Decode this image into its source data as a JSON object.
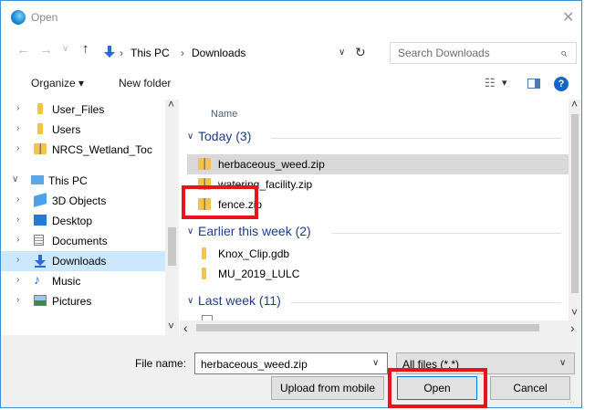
{
  "window": {
    "title": "Open",
    "close_glyph": "✕",
    "icon": "edge-browser-icon"
  },
  "nav": {
    "back_glyph": "←",
    "forward_glyph": "→",
    "recent_glyph": "∨",
    "up_glyph": "↑",
    "breadcrumb": [
      "This PC",
      "Downloads"
    ],
    "separator": "›",
    "dropdown_glyph": "∨",
    "refresh_glyph": "↻",
    "search_placeholder": "Search Downloads",
    "search_glyph": "⌕"
  },
  "toolbar": {
    "organize_label": "Organize",
    "organize_caret": "▾",
    "new_folder_label": "New folder",
    "view_glyph": "☷",
    "view_caret": "▾",
    "help_glyph": "?"
  },
  "tree": [
    {
      "label": "User_Files",
      "icon": "folder-icon",
      "chevron": "›"
    },
    {
      "label": "Users",
      "icon": "folder-icon",
      "chevron": "›"
    },
    {
      "label": "NRCS_Wetland_Toc",
      "icon": "zip-folder-icon",
      "chevron": "›"
    },
    {
      "label": "This PC",
      "icon": "computer-icon",
      "chevron": "∨"
    },
    {
      "label": "3D Objects",
      "icon": "3d-objects-icon",
      "chevron": "›"
    },
    {
      "label": "Desktop",
      "icon": "desktop-icon",
      "chevron": "›"
    },
    {
      "label": "Documents",
      "icon": "documents-icon",
      "chevron": "›"
    },
    {
      "label": "Downloads",
      "icon": "downloads-icon",
      "chevron": "›",
      "selected": true
    },
    {
      "label": "Music",
      "icon": "music-icon",
      "chevron": "›"
    },
    {
      "label": "Pictures",
      "icon": "pictures-icon",
      "chevron": "›"
    }
  ],
  "files": {
    "column_name": "Name",
    "groups": [
      {
        "label": "Today (3)",
        "items": [
          "herbaceous_weed.zip",
          "watering_facility.zip",
          "fence.zip"
        ]
      },
      {
        "label": "Earlier this week (2)",
        "items": [
          "Knox_Clip.gdb",
          "MU_2019_LULC"
        ]
      },
      {
        "label": "Last week (11)",
        "items": []
      }
    ],
    "group_chevron": "∨"
  },
  "bottom": {
    "file_name_label": "File name:",
    "file_name_value": "herbaceous_weed.zip",
    "file_type_value": "All files (*.*)",
    "dropdown_glyph": "∨",
    "upload_label": "Upload from mobile",
    "open_label": "Open",
    "cancel_label": "Cancel"
  },
  "scroll": {
    "up_glyph": "˄",
    "down_glyph": "˅",
    "left_glyph": "‹",
    "right_glyph": "›"
  },
  "colors": {
    "highlight": "#e8141b",
    "selection": "#cce8ff",
    "group_text": "#1e3d8f"
  }
}
